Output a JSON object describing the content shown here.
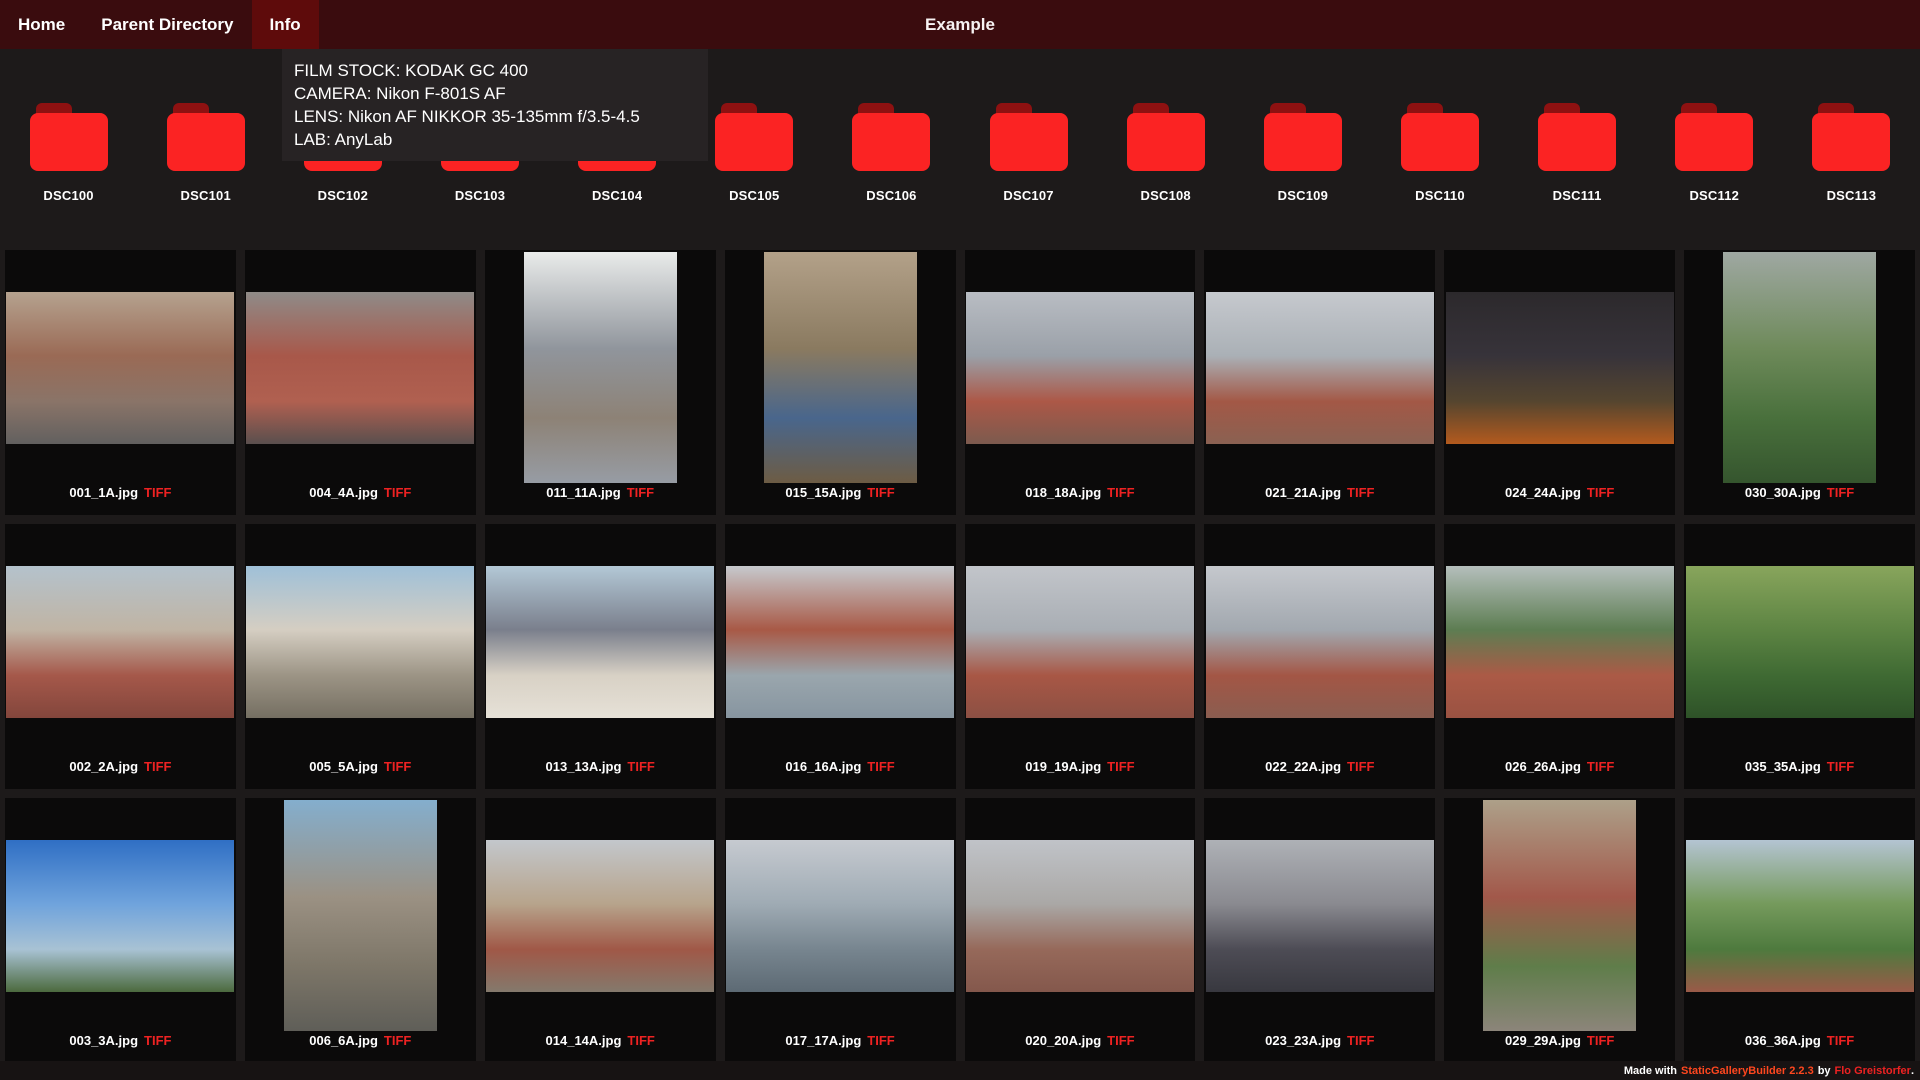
{
  "nav": {
    "items": [
      {
        "label": "Home",
        "active": false
      },
      {
        "label": "Parent Directory",
        "active": false
      },
      {
        "label": "Info",
        "active": true
      }
    ],
    "title": "Example"
  },
  "info_panel": {
    "lines": [
      "FILM STOCK: KODAK GC 400",
      "CAMERA: Nikon F-801S AF",
      "LENS: Nikon AF NIKKOR 35-135mm f/3.5-4.5",
      "LAB: AnyLab"
    ]
  },
  "folders": [
    "DSC100",
    "DSC101",
    "DSC102",
    "DSC103",
    "DSC104",
    "DSC105",
    "DSC106",
    "DSC107",
    "DSC108",
    "DSC109",
    "DSC110",
    "DSC111",
    "DSC112",
    "DSC113"
  ],
  "gallery": {
    "format_label": "TIFF",
    "rows": [
      [
        {
          "name": "001_1A.jpg",
          "orientation": "landscape",
          "palette": [
            "#b5a28f",
            "#9a6a55",
            "#8a7468",
            "#62605f"
          ]
        },
        {
          "name": "004_4A.jpg",
          "orientation": "landscape",
          "palette": [
            "#8f8b88",
            "#a8584a",
            "#b06050",
            "#5a4f4e"
          ]
        },
        {
          "name": "011_11A.jpg",
          "orientation": "portrait",
          "palette": [
            "#e9ebea",
            "#90959c",
            "#8d8276",
            "#979ca4"
          ]
        },
        {
          "name": "015_15A.jpg",
          "orientation": "portrait",
          "palette": [
            "#b3a189",
            "#8a7a60",
            "#49668c",
            "#6d5c44"
          ]
        },
        {
          "name": "018_18A.jpg",
          "orientation": "landscape",
          "palette": [
            "#b9bdc3",
            "#9aa0a8",
            "#ac5847",
            "#7c5a4e"
          ]
        },
        {
          "name": "021_21A.jpg",
          "orientation": "landscape",
          "palette": [
            "#c6c9ce",
            "#aab0b6",
            "#a35846",
            "#8a6152"
          ]
        },
        {
          "name": "024_24A.jpg",
          "orientation": "landscape",
          "palette": [
            "#2c292c",
            "#37333a",
            "#55452f",
            "#b35a1e"
          ]
        },
        {
          "name": "030_30A.jpg",
          "orientation": "portrait",
          "palette": [
            "#9fa8a2",
            "#6e8a5a",
            "#49703c",
            "#35552e"
          ]
        }
      ],
      [
        {
          "name": "002_2A.jpg",
          "orientation": "landscape",
          "palette": [
            "#b4c2cc",
            "#c0b4a4",
            "#a5584a",
            "#83463c"
          ]
        },
        {
          "name": "005_5A.jpg",
          "orientation": "landscape",
          "palette": [
            "#9fc0d8",
            "#d5cec2",
            "#9c9485",
            "#756f62"
          ]
        },
        {
          "name": "013_13A.jpg",
          "orientation": "landscape",
          "palette": [
            "#b3c8d6",
            "#7a7f8c",
            "#d8d1c5",
            "#e6e1d7"
          ]
        },
        {
          "name": "016_16A.jpg",
          "orientation": "landscape",
          "palette": [
            "#c6c9cd",
            "#a85946",
            "#9aa6ad",
            "#8795a0"
          ]
        },
        {
          "name": "019_19A.jpg",
          "orientation": "landscape",
          "palette": [
            "#c2c5ca",
            "#a9aeb4",
            "#a85745",
            "#8c5044"
          ]
        },
        {
          "name": "022_22A.jpg",
          "orientation": "landscape",
          "palette": [
            "#c5c8cd",
            "#a2a8af",
            "#a35645",
            "#8a5d50"
          ]
        },
        {
          "name": "026_26A.jpg",
          "orientation": "landscape",
          "palette": [
            "#b5bfbc",
            "#5d7d52",
            "#ab5a46",
            "#9a5242"
          ]
        },
        {
          "name": "035_35A.jpg",
          "orientation": "landscape",
          "palette": [
            "#88a55c",
            "#5d8443",
            "#3f6a33",
            "#2e5228"
          ]
        }
      ],
      [
        {
          "name": "003_3A.jpg",
          "orientation": "landscape",
          "palette": [
            "#2f6fc4",
            "#6fa3dc",
            "#a8c2d4",
            "#4c6a3e"
          ]
        },
        {
          "name": "006_6A.jpg",
          "orientation": "portrait",
          "palette": [
            "#84aecd",
            "#9b9183",
            "#7d7668",
            "#5f5e58"
          ]
        },
        {
          "name": "014_14A.jpg",
          "orientation": "landscape",
          "palette": [
            "#c3c7cc",
            "#b7a48c",
            "#a05847",
            "#84796c"
          ]
        },
        {
          "name": "017_17A.jpg",
          "orientation": "landscape",
          "palette": [
            "#c6cad0",
            "#9fabb4",
            "#77858f",
            "#5d6a74"
          ]
        },
        {
          "name": "020_20A.jpg",
          "orientation": "landscape",
          "palette": [
            "#c0c3c8",
            "#aaa8a6",
            "#96695a",
            "#84584c"
          ]
        },
        {
          "name": "023_23A.jpg",
          "orientation": "landscape",
          "palette": [
            "#aeb1b6",
            "#8a8a90",
            "#4d4c55",
            "#38383f"
          ]
        },
        {
          "name": "029_29A.jpg",
          "orientation": "portrait",
          "palette": [
            "#ada089",
            "#a2584a",
            "#5f7d4a",
            "#8c857a"
          ]
        },
        {
          "name": "036_36A.jpg",
          "orientation": "landscape",
          "palette": [
            "#b4c4d2",
            "#759a5c",
            "#4e7a3e",
            "#9a5a48"
          ]
        }
      ]
    ]
  },
  "footer": {
    "prefix": "Made with",
    "builder": "StaticGalleryBuilder 2.2.3",
    "middle": "by",
    "author": "Flo Greistorfer",
    "suffix": "."
  },
  "colors": {
    "nav_background": "#3a0c0e",
    "nav_active": "#5e0b0b",
    "page_background": "#1d1a1a",
    "cell_background": "#0b0a0a",
    "panel_background": "#272324",
    "folder_red": "#fb2323",
    "folder_tab_red": "#8e1111",
    "tiff_red": "#ee2222",
    "builder_link": "#ff471f",
    "author_link": "#ee2222"
  }
}
